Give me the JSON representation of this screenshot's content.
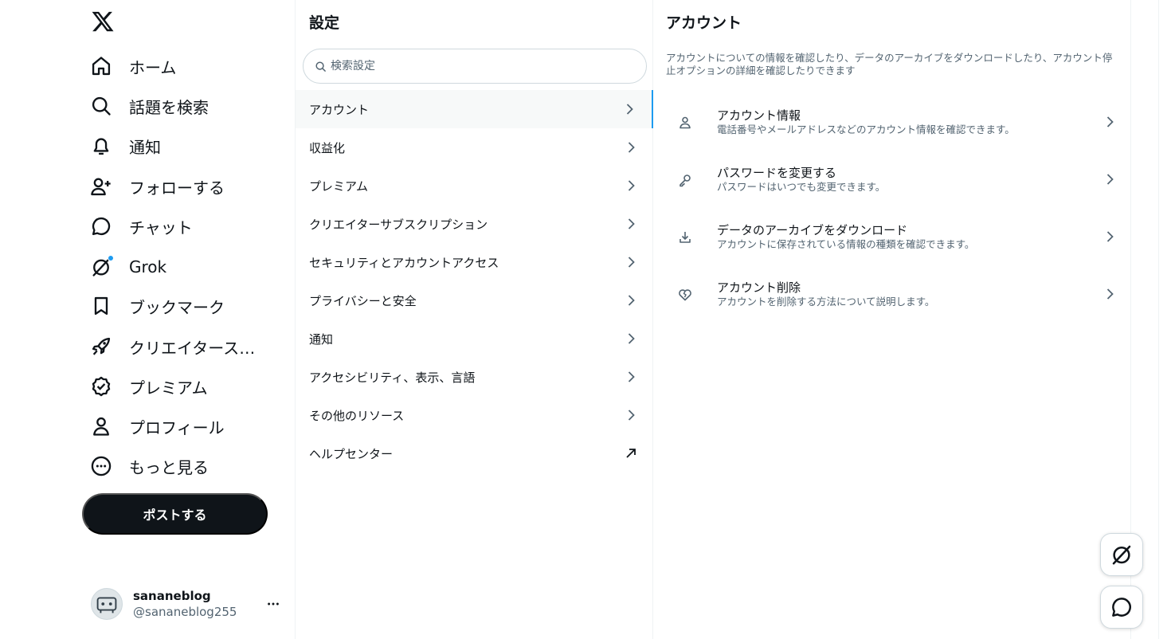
{
  "nav": {
    "items": [
      {
        "label": "ホーム",
        "icon": "home-icon"
      },
      {
        "label": "話題を検索",
        "icon": "search-icon"
      },
      {
        "label": "通知",
        "icon": "bell-icon"
      },
      {
        "label": "フォローする",
        "icon": "add-person-icon"
      },
      {
        "label": "チャット",
        "icon": "chat-bubble-icon"
      },
      {
        "label": "Grok",
        "icon": "grok-icon"
      },
      {
        "label": "ブックマーク",
        "icon": "bookmark-icon"
      },
      {
        "label": "クリエイタースタジオ",
        "icon": "rocket-icon"
      },
      {
        "label": "プレミアム",
        "icon": "verified-badge-icon"
      },
      {
        "label": "プロフィール",
        "icon": "person-icon"
      },
      {
        "label": "もっと見る",
        "icon": "more-circle-icon"
      }
    ],
    "post_button": "ポストする",
    "account": {
      "name": "sananeblog",
      "handle": "@sananeblog255"
    }
  },
  "settings": {
    "title": "設定",
    "search_placeholder": "検索設定",
    "items": [
      {
        "label": "アカウント",
        "active": true,
        "icon": "chevron-right-icon"
      },
      {
        "label": "収益化",
        "icon": "chevron-right-icon"
      },
      {
        "label": "プレミアム",
        "icon": "chevron-right-icon"
      },
      {
        "label": "クリエイターサブスクリプション",
        "icon": "chevron-right-icon"
      },
      {
        "label": "セキュリティとアカウントアクセス",
        "icon": "chevron-right-icon"
      },
      {
        "label": "プライバシーと安全",
        "icon": "chevron-right-icon"
      },
      {
        "label": "通知",
        "icon": "chevron-right-icon"
      },
      {
        "label": "アクセシビリティ、表示、言語",
        "icon": "chevron-right-icon"
      },
      {
        "label": "その他のリソース",
        "icon": "chevron-right-icon"
      },
      {
        "label": "ヘルプセンター",
        "icon": "external-link-icon"
      }
    ]
  },
  "account_panel": {
    "title": "アカウント",
    "description": "アカウントについての情報を確認したり、データのアーカイブをダウンロードしたり、アカウント停止オプションの詳細を確認したりできます",
    "options": [
      {
        "title": "アカウント情報",
        "subtitle": "電話番号やメールアドレスなどのアカウント情報を確認できます。",
        "icon": "person-outline-icon"
      },
      {
        "title": "パスワードを変更する",
        "subtitle": "パスワードはいつでも変更できます。",
        "icon": "key-icon"
      },
      {
        "title": "データのアーカイブをダウンロード",
        "subtitle": "アカウントに保存されている情報の種類を確認できます。",
        "icon": "download-icon"
      },
      {
        "title": "アカウント削除",
        "subtitle": "アカウントを削除する方法について説明します。",
        "icon": "broken-heart-icon"
      }
    ]
  },
  "floating": {
    "grok": "grok-icon",
    "chat": "chat-bubble-icon"
  },
  "colors": {
    "accent": "#1d9bf0",
    "text": "#0f1419",
    "secondary": "#536471",
    "border": "#eff3f4"
  }
}
